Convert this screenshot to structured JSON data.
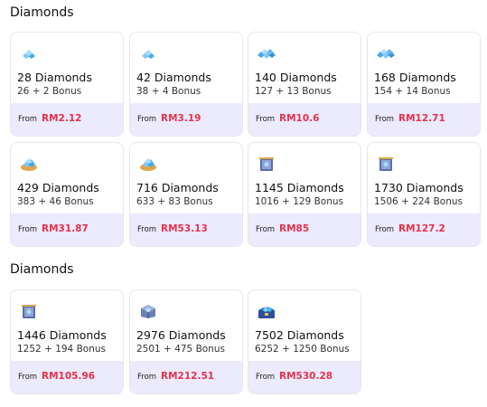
{
  "sections": [
    {
      "title": "Diamonds",
      "items": [
        {
          "name": "28 Diamonds",
          "bonus": "26 + 2 Bonus",
          "from": "From",
          "price": "RM2.12",
          "icon": "small-diamond-pile-icon"
        },
        {
          "name": "42 Diamonds",
          "bonus": "38 + 4 Bonus",
          "from": "From",
          "price": "RM3.19",
          "icon": "small-diamond-pile-icon"
        },
        {
          "name": "140 Diamonds",
          "bonus": "127 + 13 Bonus",
          "from": "From",
          "price": "RM10.6",
          "icon": "diamond-pile-icon"
        },
        {
          "name": "168 Diamonds",
          "bonus": "154 + 14 Bonus",
          "from": "From",
          "price": "RM12.71",
          "icon": "diamond-pile-icon"
        },
        {
          "name": "429 Diamonds",
          "bonus": "383 + 46 Bonus",
          "from": "From",
          "price": "RM31.87",
          "icon": "diamond-bag-icon"
        },
        {
          "name": "716 Diamonds",
          "bonus": "633 + 83 Bonus",
          "from": "From",
          "price": "RM53.13",
          "icon": "diamond-bag-icon"
        },
        {
          "name": "1145 Diamonds",
          "bonus": "1016 + 129 Bonus",
          "from": "From",
          "price": "RM85",
          "icon": "diamond-box-icon"
        },
        {
          "name": "1730 Diamonds",
          "bonus": "1506 + 224 Bonus",
          "from": "From",
          "price": "RM127.2",
          "icon": "diamond-box-icon"
        }
      ]
    },
    {
      "title": "Diamonds",
      "items": [
        {
          "name": "1446 Diamonds",
          "bonus": "1252 + 194 Bonus",
          "from": "From",
          "price": "RM105.96",
          "icon": "diamond-box-icon"
        },
        {
          "name": "2976 Diamonds",
          "bonus": "2501 + 475 Bonus",
          "from": "From",
          "price": "RM212.51",
          "icon": "diamond-crate-icon"
        },
        {
          "name": "7502 Diamonds",
          "bonus": "6252 + 1250 Bonus",
          "from": "From",
          "price": "RM530.28",
          "icon": "diamond-chest-icon"
        }
      ]
    }
  ],
  "colors": {
    "price": "#e5334b",
    "price_bar_bg": "#eceafd",
    "card_border": "#e6e6ee"
  }
}
